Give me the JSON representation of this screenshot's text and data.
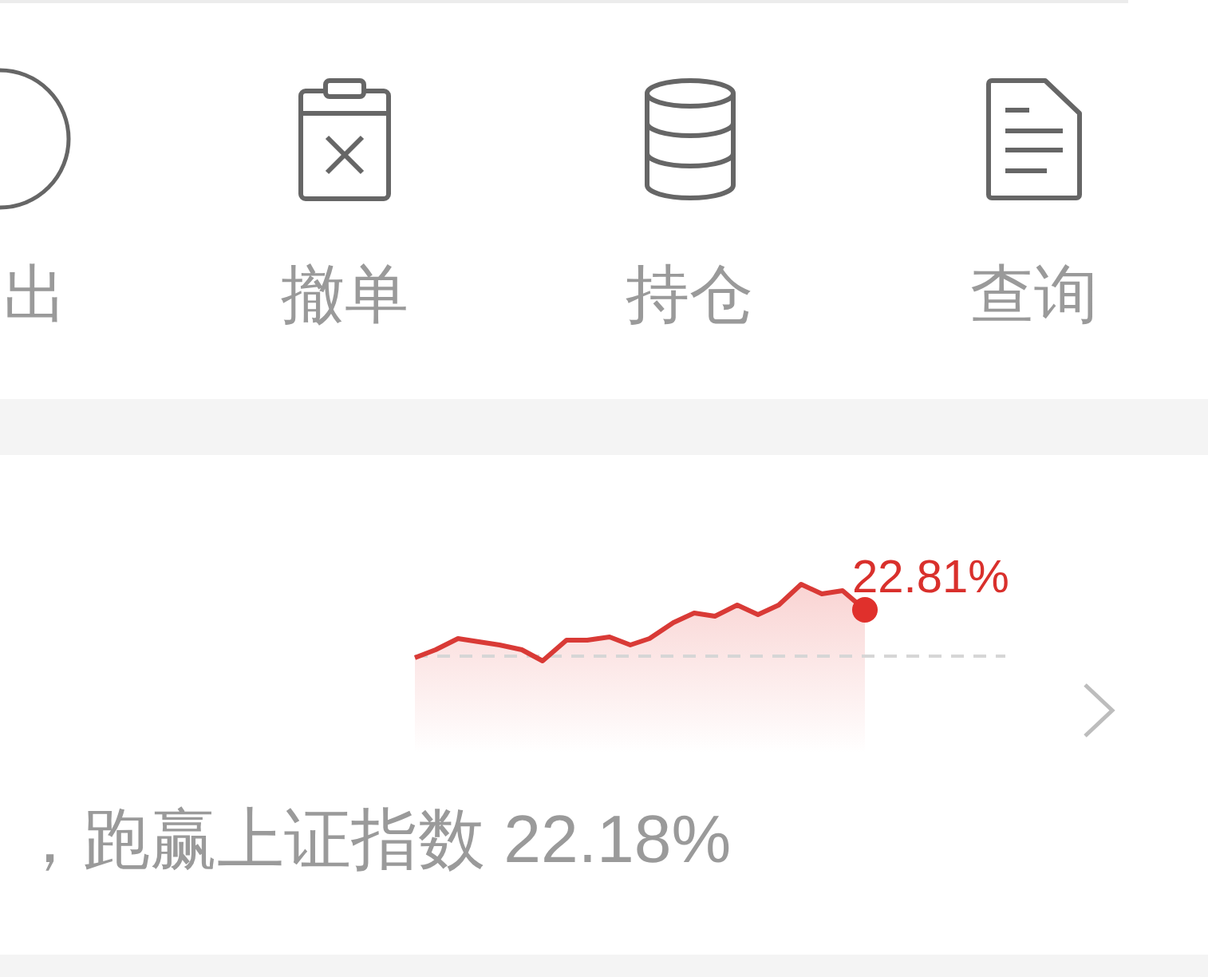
{
  "actions": [
    {
      "kind": "sell",
      "label": "出"
    },
    {
      "kind": "cancel",
      "label": "撤单"
    },
    {
      "kind": "holdings",
      "label": "持仓"
    },
    {
      "kind": "query",
      "label": "查询"
    }
  ],
  "performance": {
    "return_label": "22.81%",
    "summary": "，跑赢上证指数 22.18%"
  }
}
